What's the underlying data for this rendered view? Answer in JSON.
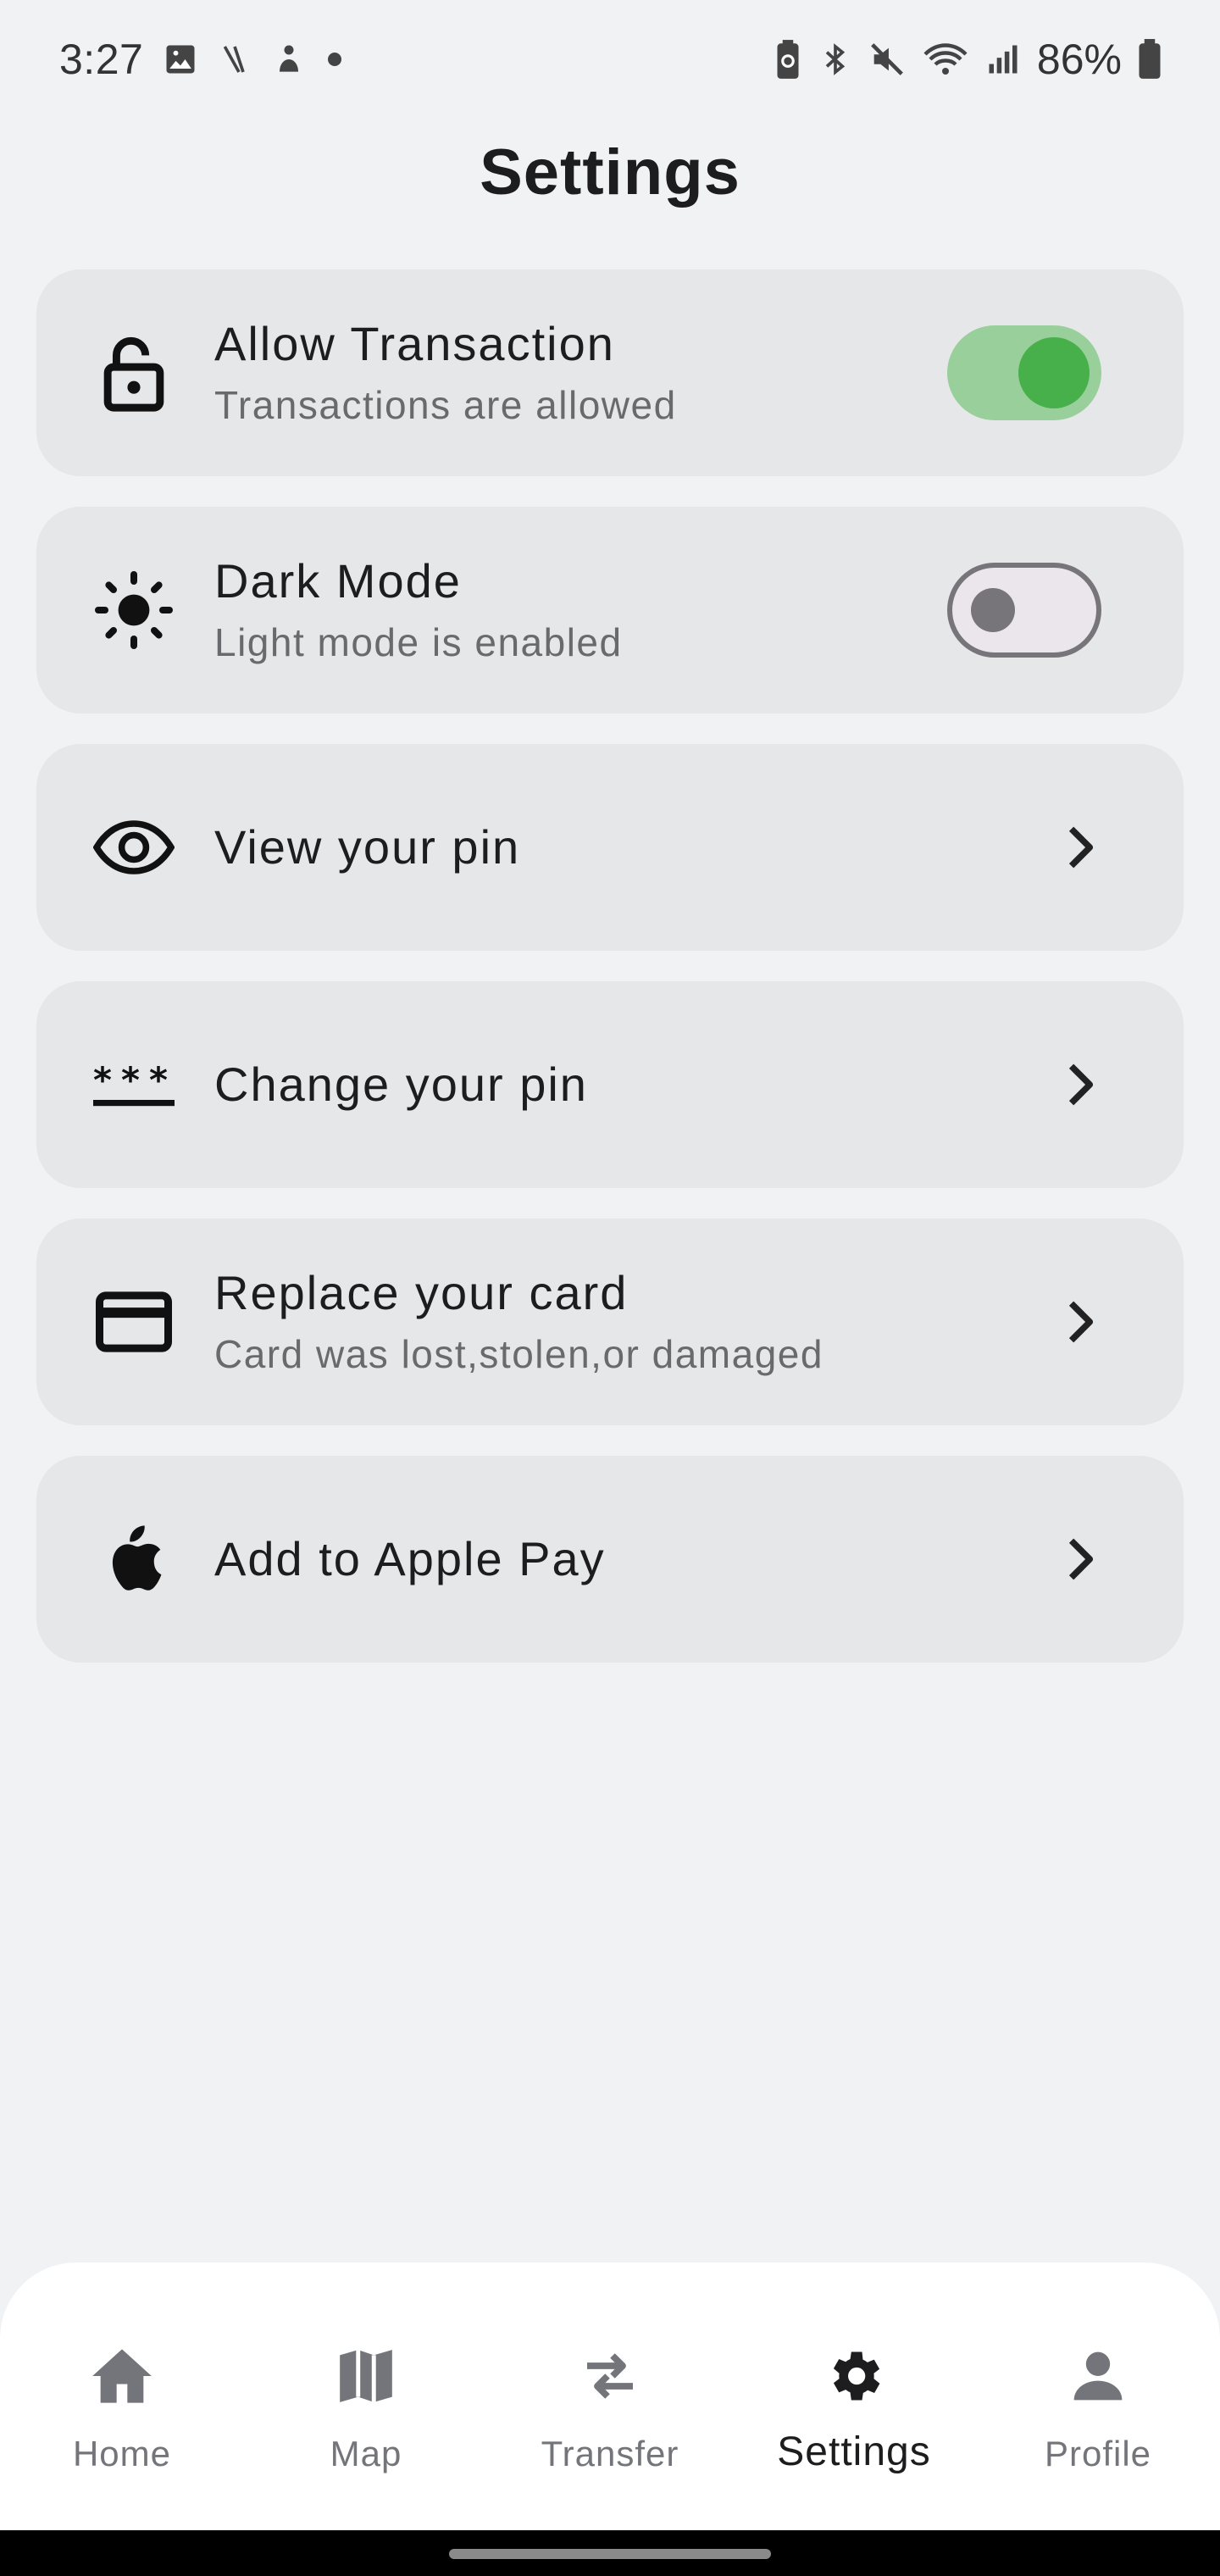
{
  "status_bar": {
    "time": "3:27",
    "battery_percent": "86%",
    "left_icons": [
      "image-icon",
      "slash-icon",
      "person-icon",
      "dot-icon"
    ],
    "right_icons": [
      "battery-saver-icon",
      "bluetooth-icon",
      "mute-icon",
      "wifi-icon",
      "signal-icon",
      "battery-icon"
    ]
  },
  "header": {
    "title": "Settings"
  },
  "settings": [
    {
      "title": "Allow Transaction",
      "subtitle": "Transactions are allowed",
      "icon": "lock-open-icon",
      "control": "toggle",
      "on": true
    },
    {
      "title": "Dark Mode",
      "subtitle": "Light mode is enabled",
      "icon": "sun-icon",
      "control": "toggle",
      "on": false
    },
    {
      "title": "View your pin",
      "icon": "eye-icon",
      "control": "chevron"
    },
    {
      "title": "Change your pin",
      "icon": "password-icon",
      "control": "chevron"
    },
    {
      "title": "Replace your card",
      "subtitle": "Card was lost,stolen,or damaged",
      "icon": "credit-card-icon",
      "control": "chevron"
    },
    {
      "title": "Add to Apple Pay",
      "icon": "apple-icon",
      "control": "chevron"
    }
  ],
  "bottom_nav": {
    "items": [
      {
        "label": "Home",
        "icon": "home-icon"
      },
      {
        "label": "Map",
        "icon": "map-icon"
      },
      {
        "label": "Transfer",
        "icon": "transfer-icon"
      },
      {
        "label": "Settings",
        "icon": "gear-icon",
        "active": true
      },
      {
        "label": "Profile",
        "icon": "person-icon"
      }
    ]
  },
  "colors": {
    "background": "#f1f2f4",
    "card": "#e6e7e9",
    "toggle_on_track": "#98cf9a",
    "toggle_on_knob": "#47b04b",
    "toggle_off_outline": "#77757a",
    "nav_inactive": "#74757a",
    "nav_active": "#1d1d1f"
  }
}
